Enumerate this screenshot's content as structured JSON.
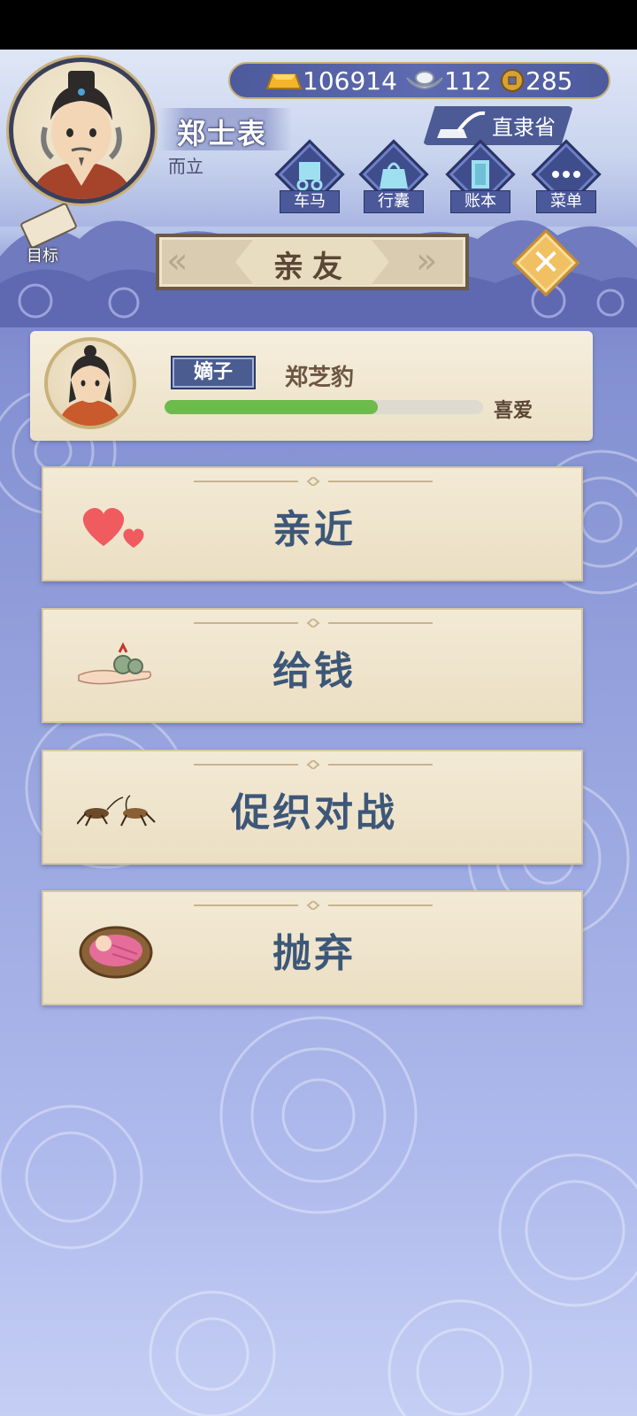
{
  "player": {
    "name": "郑士表",
    "age_title": "而立"
  },
  "currency": {
    "gold": "106914",
    "silver": "112",
    "coin": "285"
  },
  "province": "直隶省",
  "menu": [
    {
      "label": "车马",
      "icon": "carriage-icon"
    },
    {
      "label": "行囊",
      "icon": "bag-icon"
    },
    {
      "label": "账本",
      "icon": "ledger-icon"
    },
    {
      "label": "菜单",
      "icon": "more-icon"
    }
  ],
  "goal": {
    "label": "目标"
  },
  "panel": {
    "title": "亲友"
  },
  "child": {
    "role": "嫡子",
    "name": "郑芝豹",
    "affinity_label": "喜爱",
    "affinity_fraction": 0.67
  },
  "actions": [
    {
      "label": "亲近",
      "icon": "hearts-icon"
    },
    {
      "label": "给钱",
      "icon": "money-hand-icon"
    },
    {
      "label": "促织对战",
      "icon": "crickets-icon"
    },
    {
      "label": "抛弃",
      "icon": "baby-basket-icon"
    }
  ],
  "colors": {
    "accent": "#3d5778",
    "affinity": "#6cbb4b",
    "close": "#f0c062"
  }
}
